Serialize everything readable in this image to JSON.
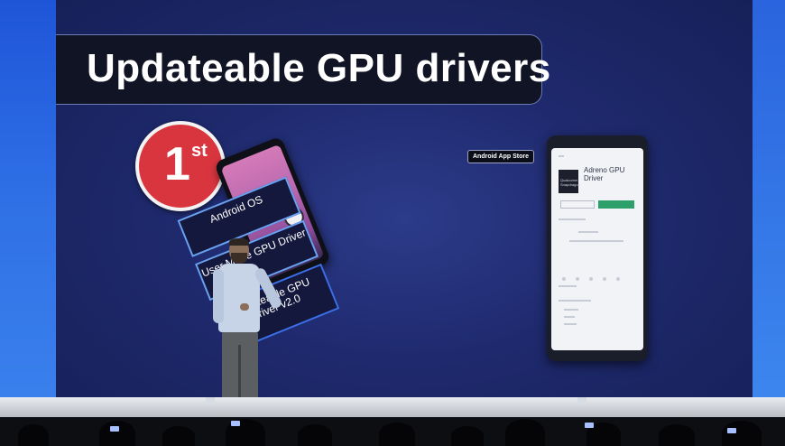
{
  "slide": {
    "title": "Updateable GPU drivers",
    "badge": {
      "number": "1",
      "superscript": "st"
    },
    "stack_layers": [
      "Android OS",
      "User Mode GPU Driver",
      "Updateable GPU Driver v2.0"
    ],
    "store_label": "Android App Store",
    "app": {
      "name": "Adreno GPU Driver",
      "icon_text": "Qualcomm Snapdragon"
    }
  },
  "colors": {
    "screen_bg": "#1f2a6e",
    "badge_red": "#d9353f",
    "side_blue": "#2f70e6",
    "install_green": "#2d9f6a"
  }
}
